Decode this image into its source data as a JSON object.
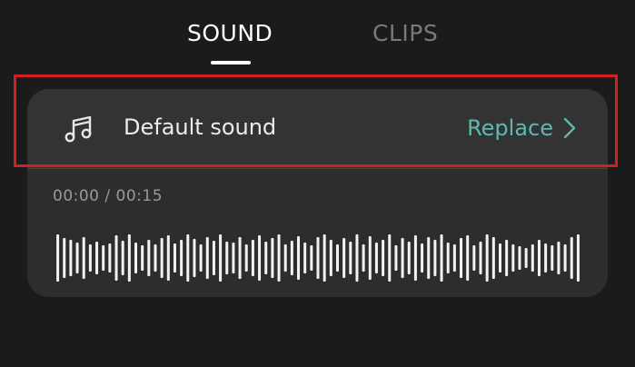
{
  "tabs": [
    {
      "label": "SOUND",
      "active": true
    },
    {
      "label": "CLIPS",
      "active": false
    }
  ],
  "sound": {
    "icon": "music-note-icon",
    "name": "Default sound",
    "action_label": "Replace",
    "action_icon": "chevron-right-icon",
    "accent_color": "#5fb8ad"
  },
  "playback": {
    "time_text": "00:00 / 00:15"
  },
  "highlight": {
    "color": "#d21f1f"
  }
}
